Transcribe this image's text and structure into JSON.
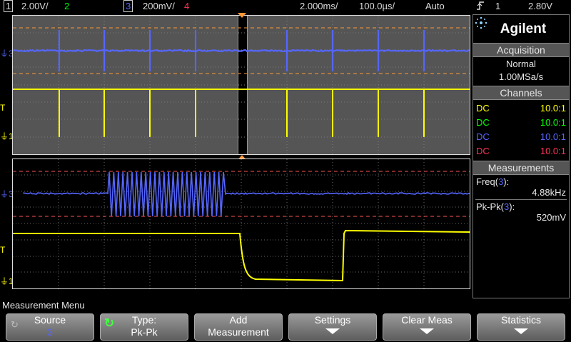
{
  "status_bar": {
    "ch1_num": "1",
    "ch1_scale": "2.00V/",
    "ch2_num": "2",
    "ch3_num": "3",
    "ch3_scale": "200mV/",
    "ch4_num": "4",
    "main_timebase": "2.000ms/",
    "zoom_timebase": "100.0µs/",
    "trigger_mode": "Auto",
    "trigger_icon": "trigger-edge-icon",
    "trigger_source": "1",
    "trigger_level": "2.80V"
  },
  "colors": {
    "ch1": "#ffff00",
    "ch2": "#00ff00",
    "ch3": "#5566ff",
    "ch4": "#ff3355",
    "grid_bg_top": "#555555",
    "grid_bg_main": "#000000",
    "cursor": "#ff9933"
  },
  "markers": {
    "ch3": "3",
    "ch1": "1",
    "trigger": "T"
  },
  "side": {
    "brand": "Agilent",
    "acquisition_title": "Acquisition",
    "acq_mode": "Normal",
    "acq_rate": "1.00MSa/s",
    "channels_title": "Channels",
    "channels": [
      {
        "coupling": "DC",
        "probe": "10.0:1",
        "color": "#ffff00"
      },
      {
        "coupling": "DC",
        "probe": "10.0:1",
        "color": "#00ff00"
      },
      {
        "coupling": "DC",
        "probe": "10.0:1",
        "color": "#5566ff"
      },
      {
        "coupling": "DC",
        "probe": "10.0:1",
        "color": "#ff3355"
      }
    ],
    "measurements_title": "Measurements",
    "meas1_label": "Freq(",
    "meas1_src": "3",
    "meas1_close": "):",
    "meas1_value": "4.88kHz",
    "meas2_label": "Pk-Pk(",
    "meas2_src": "3",
    "meas2_close": "):",
    "meas2_value": "520mV"
  },
  "menu": {
    "title": "Measurement Menu",
    "keys": [
      {
        "line1": "Source",
        "line2": "3"
      },
      {
        "line1": "Type:",
        "line2": "Pk-Pk"
      },
      {
        "line1": "Add",
        "line2": "Measurement"
      },
      {
        "line1": "Settings",
        "line2": ""
      },
      {
        "line1": "Clear Meas",
        "line2": ""
      },
      {
        "line1": "Statistics",
        "line2": ""
      }
    ]
  }
}
